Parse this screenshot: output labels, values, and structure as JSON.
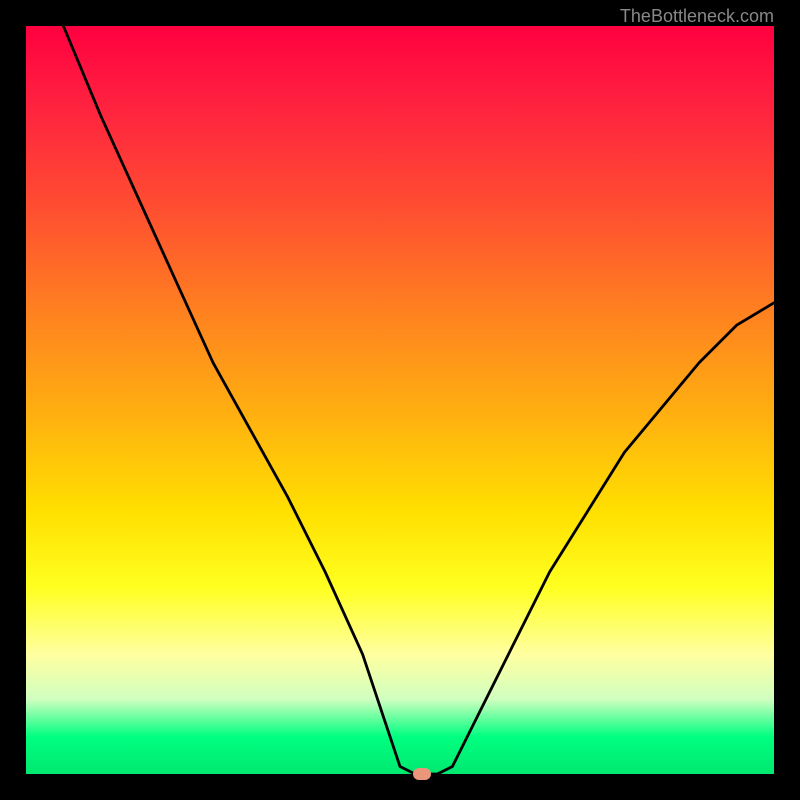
{
  "attribution": "TheBottleneck.com",
  "chart_data": {
    "type": "line",
    "title": "",
    "xlabel": "",
    "ylabel": "",
    "xlim": [
      0,
      100
    ],
    "ylim": [
      0,
      100
    ],
    "x": [
      5,
      10,
      15,
      20,
      25,
      30,
      35,
      40,
      45,
      48,
      50,
      52,
      55,
      57,
      60,
      65,
      70,
      75,
      80,
      85,
      90,
      95,
      100
    ],
    "values": [
      100,
      88,
      77,
      66,
      55,
      46,
      37,
      27,
      16,
      7,
      1,
      0,
      0,
      1,
      7,
      17,
      27,
      35,
      43,
      49,
      55,
      60,
      63
    ],
    "marker": {
      "x": 53,
      "y": 0
    },
    "gradient_bands": [
      {
        "color": "#ff0040",
        "pos": 0
      },
      {
        "color": "#ffe000",
        "pos": 65
      },
      {
        "color": "#ffffa0",
        "pos": 84
      },
      {
        "color": "#00ff80",
        "pos": 95
      }
    ]
  }
}
